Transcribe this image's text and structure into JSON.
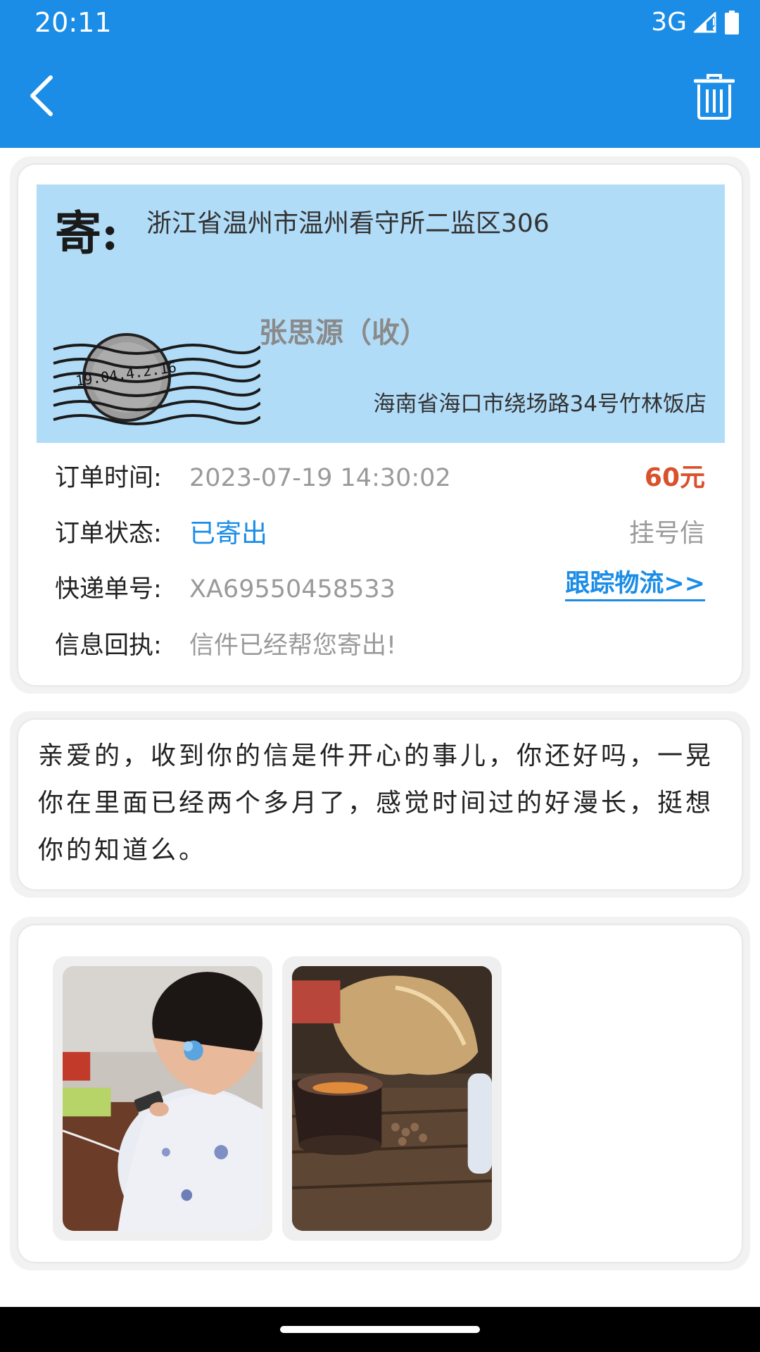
{
  "status_bar": {
    "time": "20:11",
    "network": "3G"
  },
  "toolbar": {
    "back_icon": "chevron-left-icon",
    "delete_icon": "trash-icon"
  },
  "envelope": {
    "sender_label": "寄:",
    "sender_address": "浙江省温州市温州看守所二监区306",
    "recipient_name": "张思源（收）",
    "recipient_address": "海南省海口市绕场路34号竹林饭店",
    "postmark_text": "19.04.4.2.16"
  },
  "order": {
    "time_label": "订单时间:",
    "time_value": "2023-07-19 14:30:02",
    "price": "60元",
    "status_label": "订单状态:",
    "status_value": "已寄出",
    "mail_type": "挂号信",
    "tracking_label": "快递单号:",
    "tracking_value": "XA69550458533",
    "track_link": "跟踪物流>>",
    "receipt_label": "信息回执:",
    "receipt_value": "信件已经帮您寄出!"
  },
  "message": {
    "text": "亲爱的，收到你的信是件开心的事儿，你还好吗，一晃你在里面已经两个多月了，感觉时间过的好漫长，挺想你的知道么。"
  },
  "photos": [
    {
      "icon": "photo-girl-icon"
    },
    {
      "icon": "photo-tea-icon"
    }
  ],
  "colors": {
    "primary": "#1b8de6",
    "envelope_bg": "#b1dcf8",
    "price": "#d9502c",
    "muted": "#9a9a9a"
  }
}
